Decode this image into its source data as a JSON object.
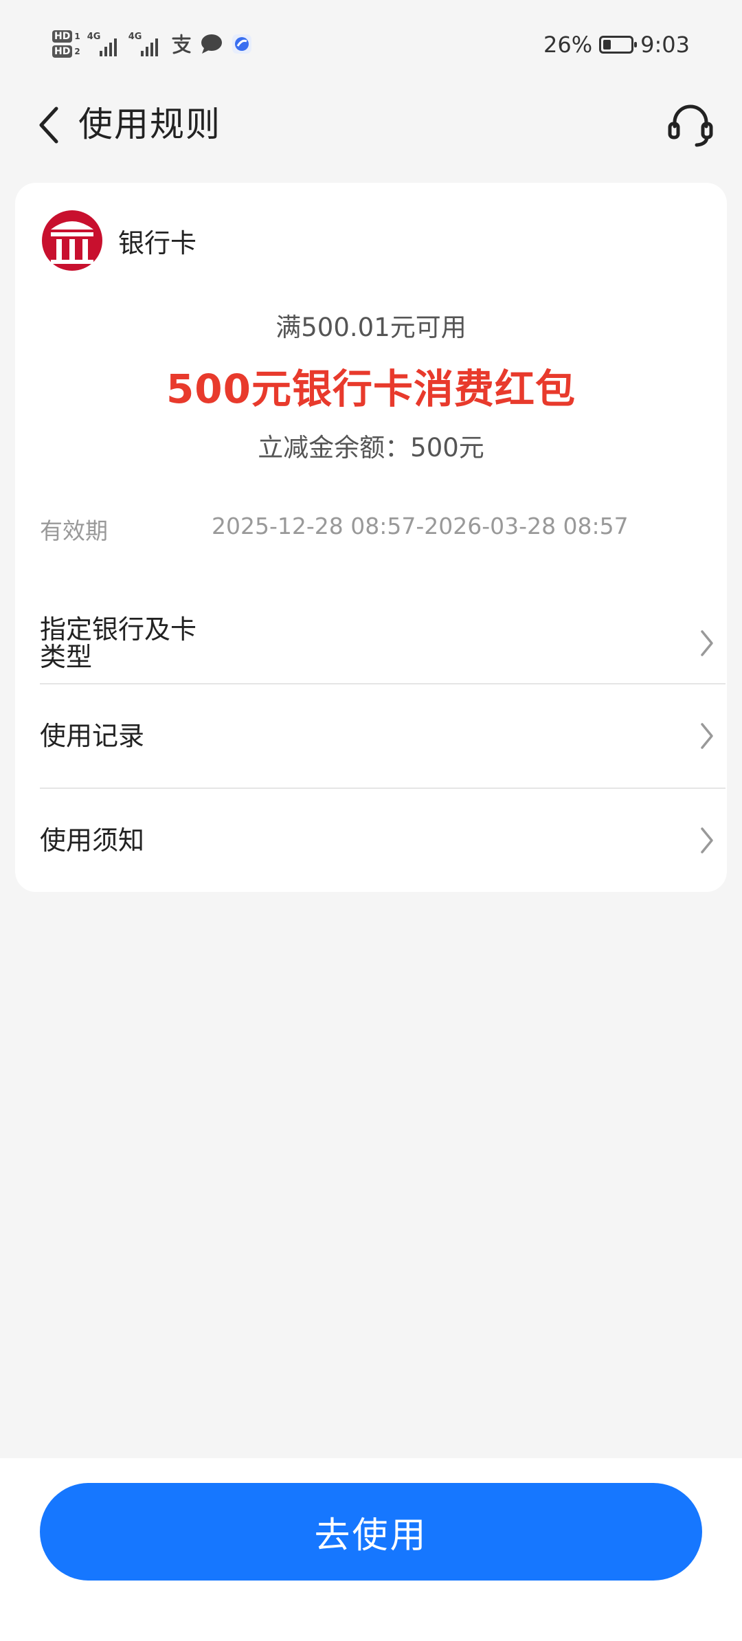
{
  "status_bar": {
    "hd1": "HD",
    "hd1_n": "1",
    "hd2": "HD",
    "hd2_n": "2",
    "net1": "4G",
    "net2": "4G",
    "battery_pct": "26%",
    "battery_level": 0.26,
    "time": "9:03",
    "icons": [
      "alipay-icon",
      "message-icon",
      "app-icon"
    ]
  },
  "header": {
    "title": "使用规则",
    "back_icon": "chevron-left-icon",
    "service_icon": "headset-icon"
  },
  "card": {
    "bank_name": "银行卡",
    "logo_icon": "bank-logo",
    "condition": "满500.01元可用",
    "amount_title": "500元银行卡消费红包",
    "balance": "立减金余额：500元",
    "validity_label": "有效期",
    "validity_value": "2025-12-28 08:57-2026-03-28 08:57",
    "menu": [
      {
        "label": "指定银行及卡类型"
      },
      {
        "label": "使用记录"
      },
      {
        "label": "使用须知"
      }
    ]
  },
  "footer": {
    "use_button": "去使用"
  },
  "colors": {
    "accent": "#1677ff",
    "highlight_red": "#e83a2c",
    "bank_red": "#c8102e"
  }
}
